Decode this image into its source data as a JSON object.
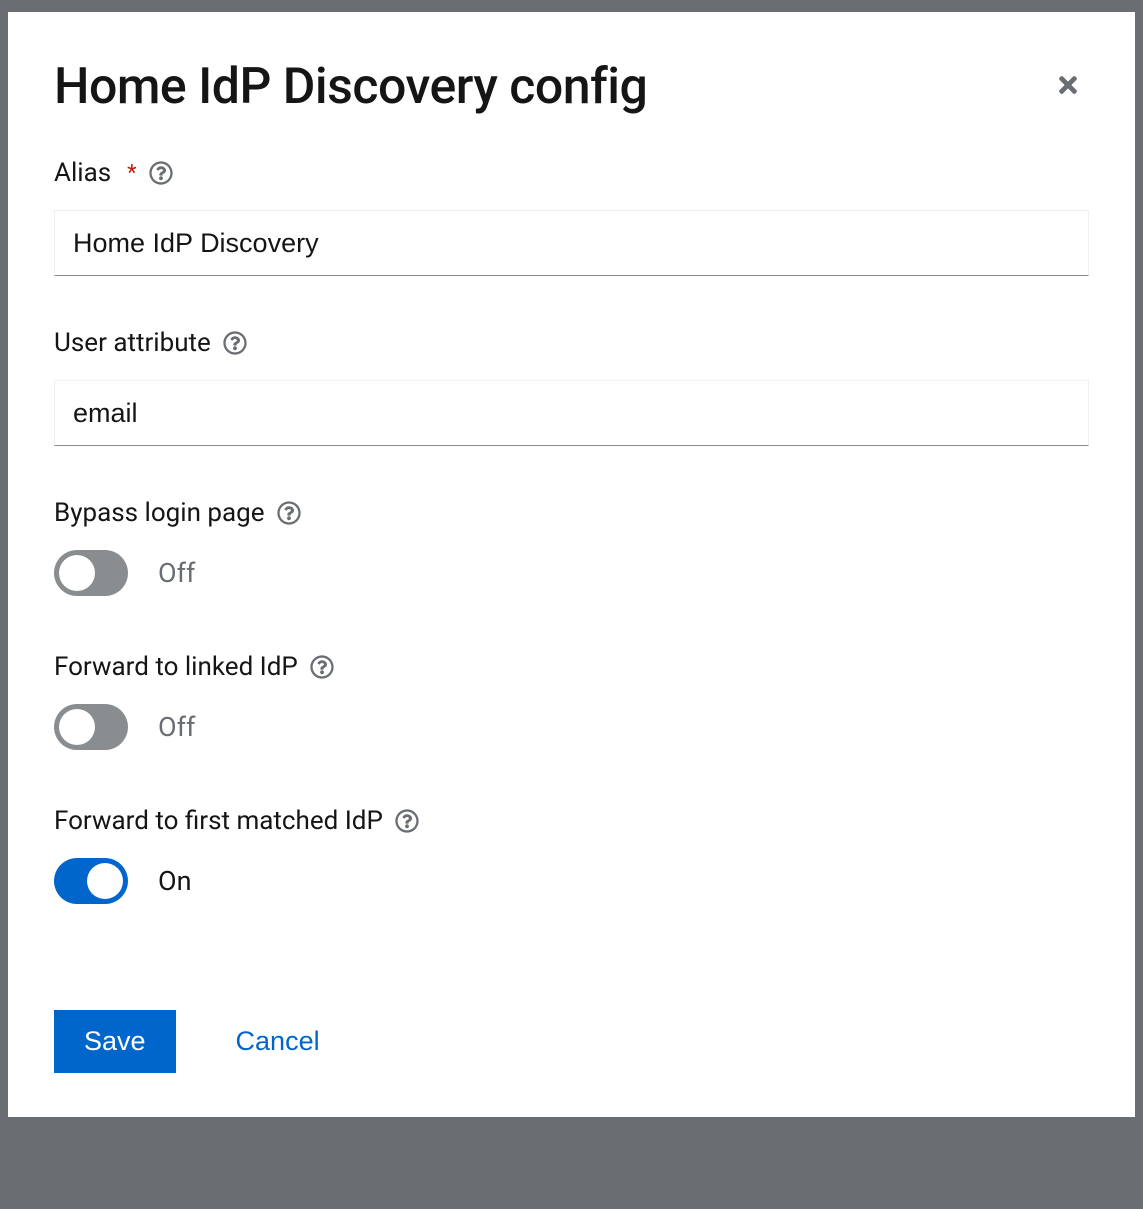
{
  "modal": {
    "title": "Home IdP Discovery config"
  },
  "fields": {
    "alias": {
      "label": "Alias",
      "value": "Home IdP Discovery",
      "required": true
    },
    "user_attribute": {
      "label": "User attribute",
      "value": "email"
    },
    "bypass_login": {
      "label": "Bypass login page",
      "state": "Off"
    },
    "forward_linked": {
      "label": "Forward to linked IdP",
      "state": "Off"
    },
    "forward_first": {
      "label": "Forward to first matched IdP",
      "state": "On"
    }
  },
  "actions": {
    "save": "Save",
    "cancel": "Cancel"
  }
}
